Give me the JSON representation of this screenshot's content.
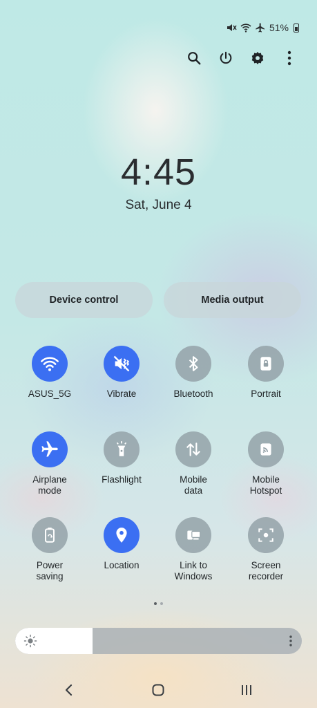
{
  "status_bar": {
    "battery": "51%",
    "icons": [
      "mute-icon",
      "wifi-icon",
      "airplane-icon",
      "battery-icon"
    ]
  },
  "top_actions": [
    "search-icon",
    "power-icon",
    "gear-icon",
    "more-vert-icon"
  ],
  "clock": {
    "time": "4:45",
    "date": "Sat, June 4"
  },
  "pills": {
    "device_control": "Device control",
    "media_output": "Media output"
  },
  "tiles": [
    {
      "label": "ASUS_5G",
      "icon": "wifi-icon",
      "on": true
    },
    {
      "label": "Vibrate",
      "icon": "vibrate-icon",
      "on": true
    },
    {
      "label": "Bluetooth",
      "icon": "bluetooth-icon",
      "on": false
    },
    {
      "label": "Portrait",
      "icon": "portrait-lock-icon",
      "on": false
    },
    {
      "label": "Airplane\nmode",
      "icon": "airplane-icon",
      "on": true
    },
    {
      "label": "Flashlight",
      "icon": "flashlight-icon",
      "on": false
    },
    {
      "label": "Mobile\ndata",
      "icon": "mobile-data-icon",
      "on": false
    },
    {
      "label": "Mobile\nHotspot",
      "icon": "hotspot-icon",
      "on": false
    },
    {
      "label": "Power\nsaving",
      "icon": "power-saving-icon",
      "on": false
    },
    {
      "label": "Location",
      "icon": "location-icon",
      "on": true
    },
    {
      "label": "Link to\nWindows",
      "icon": "link-to-windows-icon",
      "on": false
    },
    {
      "label": "Screen\nrecorder",
      "icon": "screen-recorder-icon",
      "on": false
    }
  ],
  "pager": {
    "pages": 2,
    "current": 1
  },
  "brightness": {
    "level": 0.27
  },
  "colors": {
    "accent": "#3b6ff2",
    "tile_off": "#94a2a8"
  }
}
